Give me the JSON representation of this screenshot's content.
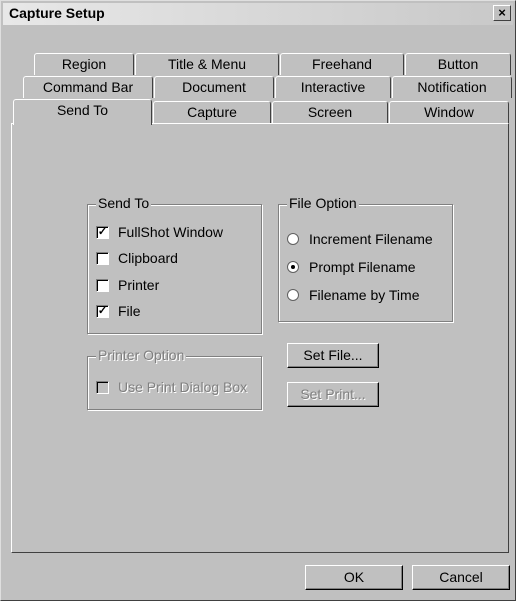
{
  "window": {
    "title": "Capture Setup",
    "close_glyph": "×"
  },
  "tabs": {
    "row1": [
      "Region",
      "Title & Menu",
      "Freehand",
      "Button"
    ],
    "row2": [
      "Command Bar",
      "Document",
      "Interactive",
      "Notification"
    ],
    "row3": [
      "Send To",
      "Capture",
      "Screen",
      "Window"
    ],
    "active": "Send To"
  },
  "send_to": {
    "label": "Send To",
    "items": [
      {
        "label": "FullShot Window",
        "checked": true
      },
      {
        "label": "Clipboard",
        "checked": false
      },
      {
        "label": "Printer",
        "checked": false
      },
      {
        "label": "File",
        "checked": true
      }
    ]
  },
  "file_option": {
    "label": "File Option",
    "items": [
      {
        "label": "Increment Filename",
        "selected": false
      },
      {
        "label": "Prompt Filename",
        "selected": true
      },
      {
        "label": "Filename by Time",
        "selected": false
      }
    ]
  },
  "printer_option": {
    "label": "Printer Option",
    "use_print_dialog": {
      "label": "Use Print Dialog Box",
      "checked": false,
      "enabled": false
    }
  },
  "buttons": {
    "set_file": "Set File...",
    "set_print": "Set Print...",
    "ok": "OK",
    "cancel": "Cancel"
  }
}
